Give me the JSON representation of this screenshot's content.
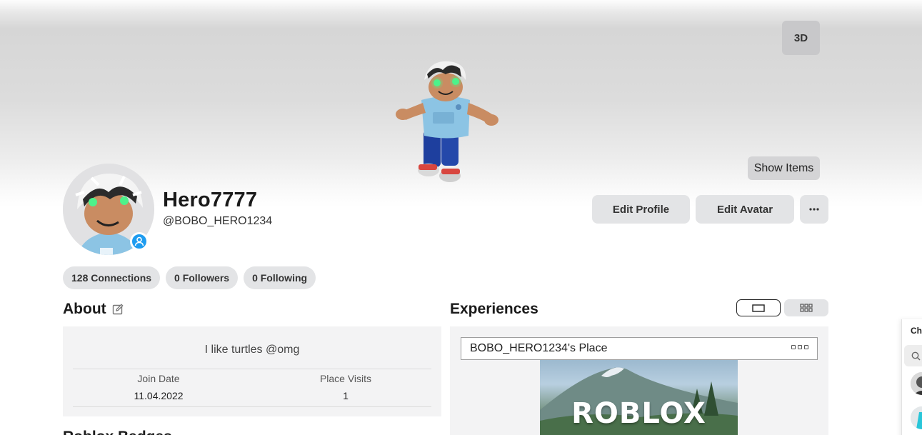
{
  "hero": {
    "view_3d_label": "3D",
    "show_items_label": "Show Items"
  },
  "profile": {
    "display_name": "Hero7777",
    "username": "@BOBO_HERO1234",
    "status": "online-icon"
  },
  "actions": {
    "edit_profile": "Edit Profile",
    "edit_avatar": "Edit Avatar",
    "more": "···"
  },
  "counts": [
    {
      "label": "128 Connections"
    },
    {
      "label": "0 Followers"
    },
    {
      "label": "0 Following"
    }
  ],
  "about": {
    "title": "About",
    "bio": "I like turtles @omg",
    "stats": [
      {
        "label": "Join Date",
        "value": "11.04.2022"
      },
      {
        "label": "Place Visits",
        "value": "1"
      }
    ],
    "next_section_title": "Roblox Badges"
  },
  "experiences": {
    "title": "Experiences",
    "place_name": "BOBO_HERO1234's Place",
    "thumbnail_text": "ROBLOX",
    "view_modes": [
      "slideshow-view-icon",
      "grid-view-icon"
    ]
  },
  "chat": {
    "label": "Chat"
  },
  "colors": {
    "status_blue": "#1e9cf0",
    "button_gray": "#e3e4e6",
    "panel_gray": "#f3f3f4"
  }
}
